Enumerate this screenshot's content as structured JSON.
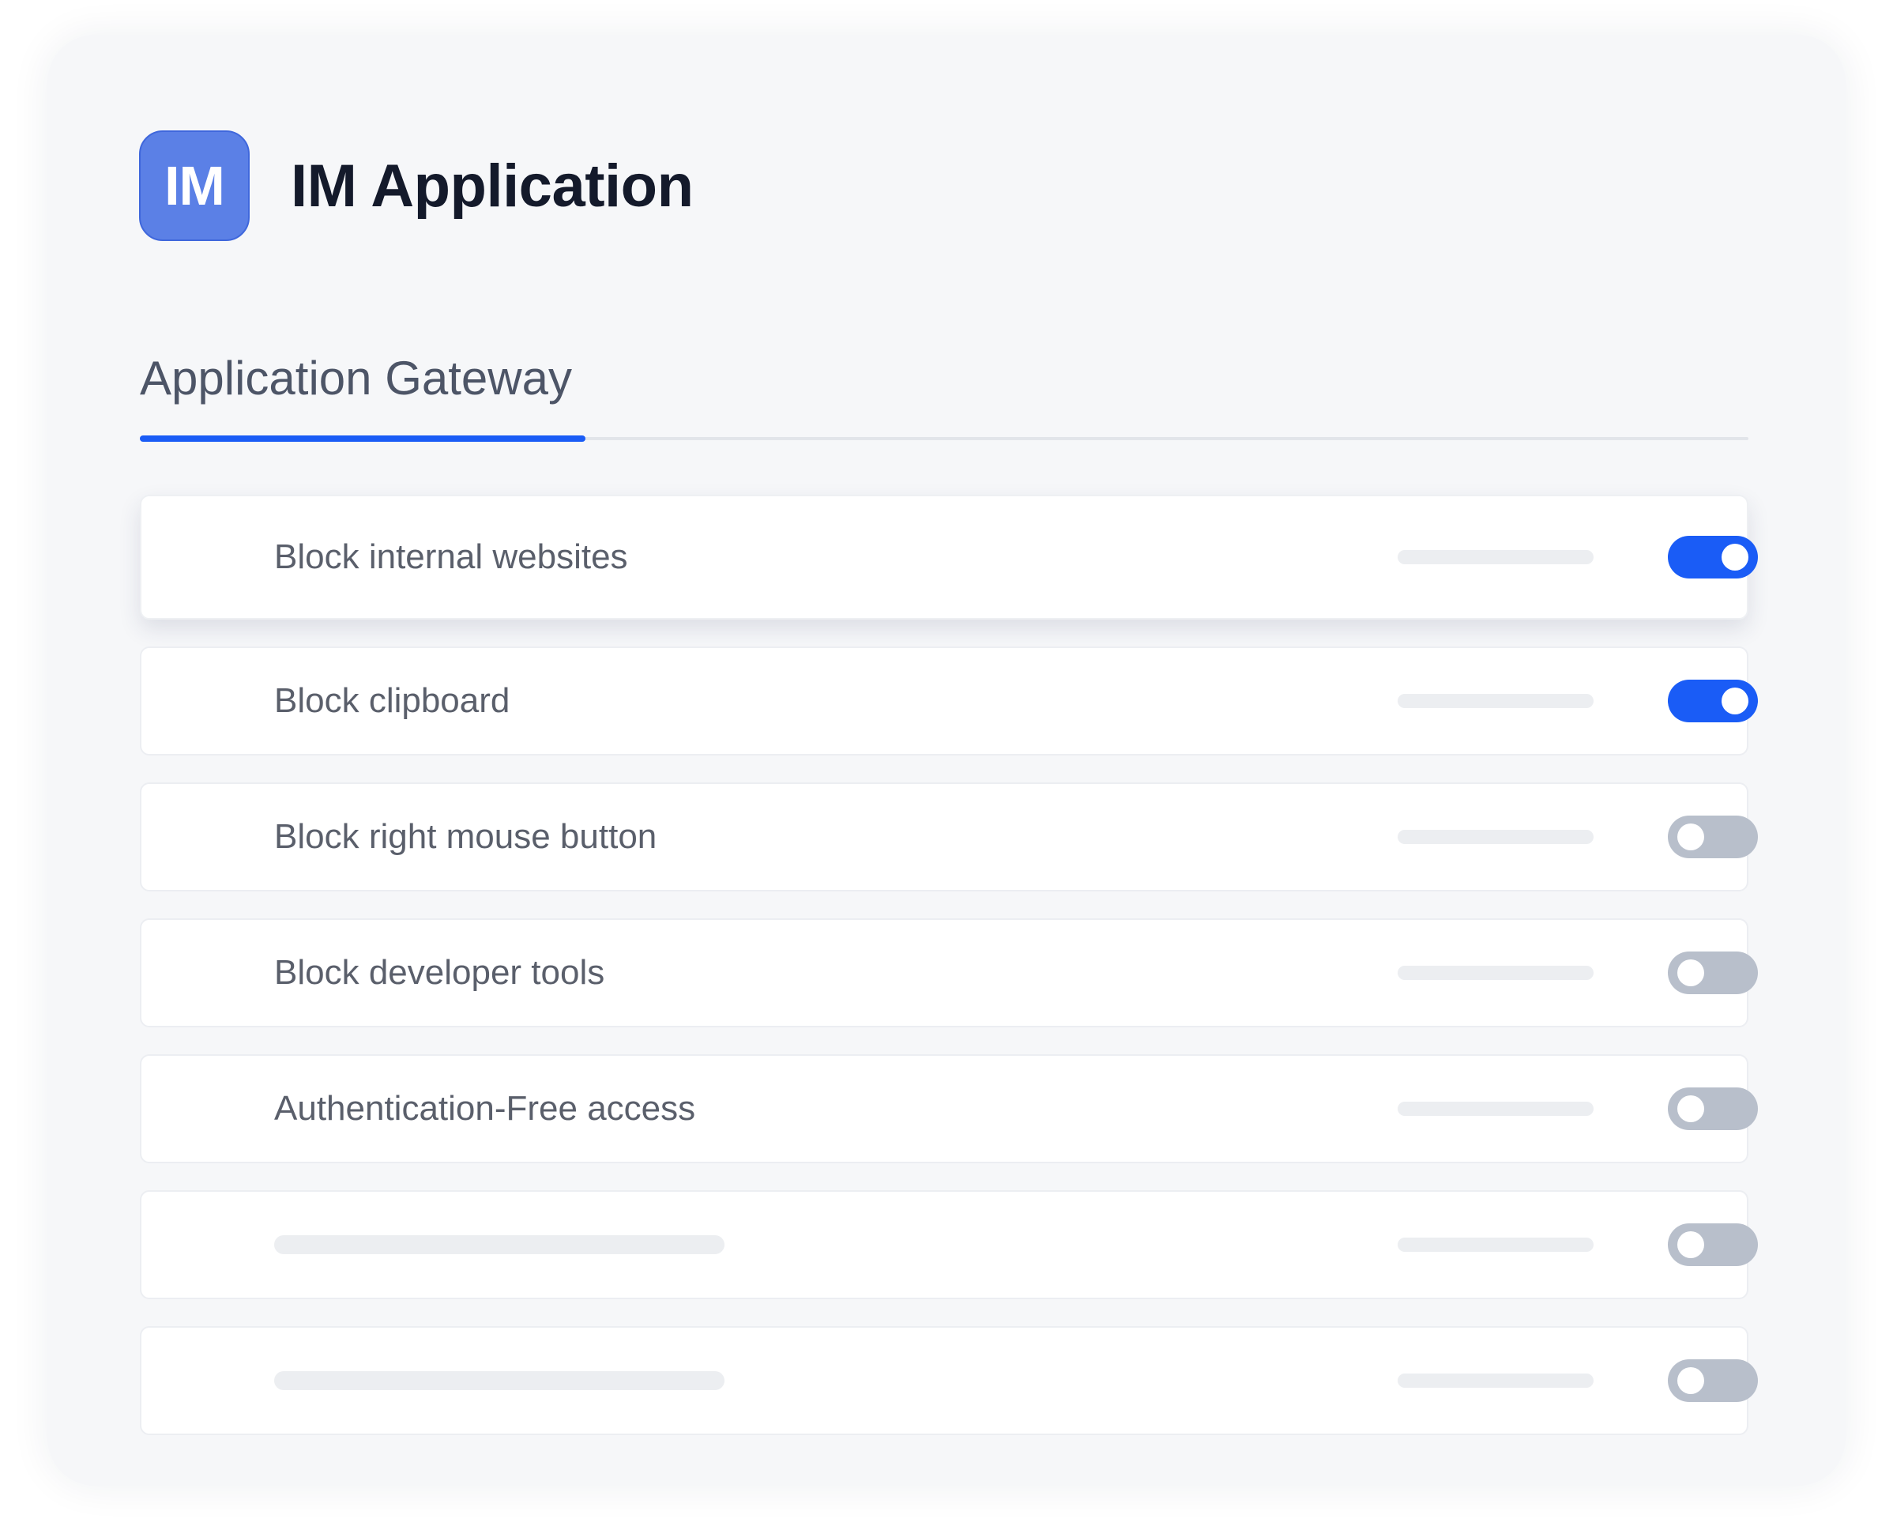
{
  "app": {
    "logo_text": "IM",
    "title": "IM Application"
  },
  "tabs": [
    {
      "label": "Application Gateway",
      "active": true
    }
  ],
  "settings": [
    {
      "label": "Block internal websites",
      "enabled": true
    },
    {
      "label": "Block clipboard",
      "enabled": true
    },
    {
      "label": "Block right mouse button",
      "enabled": false
    },
    {
      "label": "Block developer tools",
      "enabled": false
    },
    {
      "label": "Authentication-Free access",
      "enabled": false
    },
    {
      "label": "",
      "enabled": false
    },
    {
      "label": "",
      "enabled": false
    }
  ],
  "colors": {
    "accent": "#1a5cf6",
    "logo_background": "#5b80e6",
    "toggle_off": "#b8bfcb",
    "card_background": "#f6f7f9"
  }
}
